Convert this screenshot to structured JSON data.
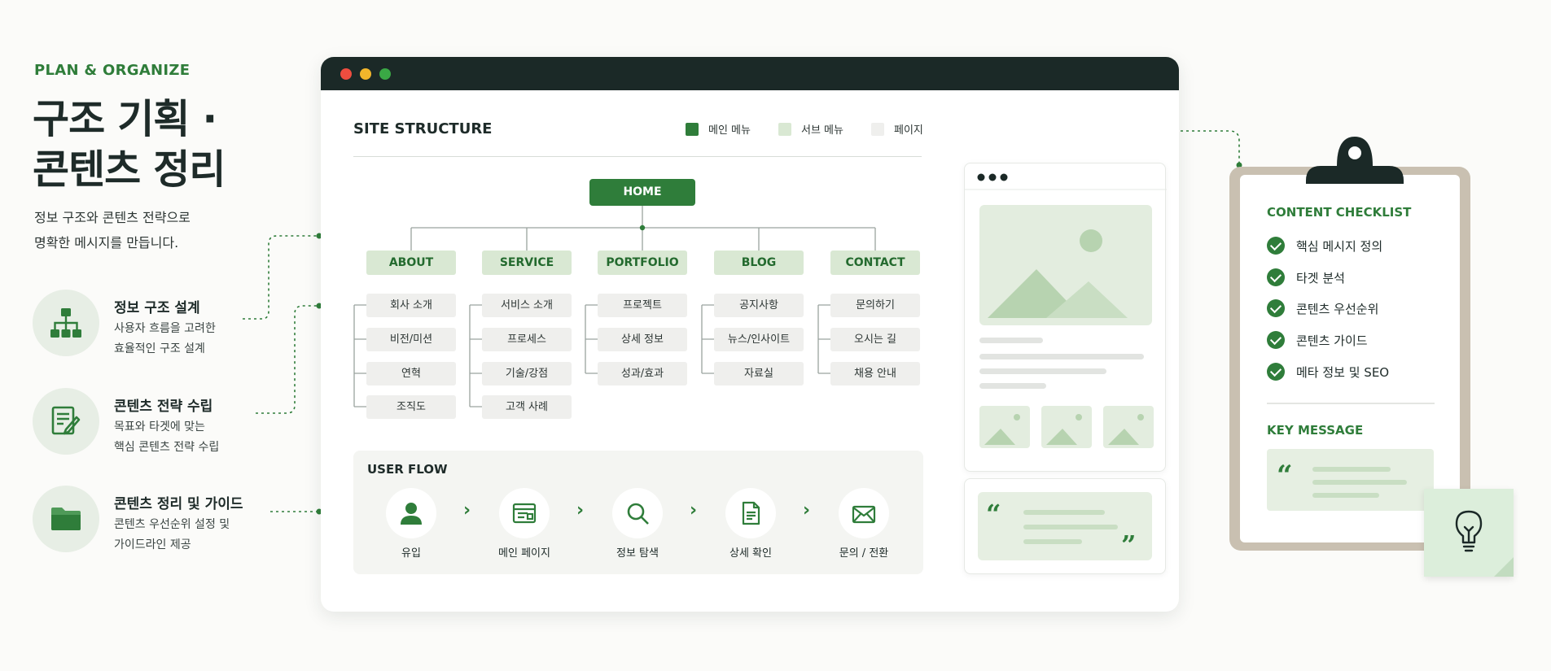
{
  "hero": {
    "eyebrow": "PLAN & ORGANIZE",
    "title_line1": "구조 기획 ·",
    "title_line2": "콘텐츠 정리",
    "intro_line1": "정보 구조와 콘텐츠 전략으로",
    "intro_line2": "명확한 메시지를 만듭니다."
  },
  "features": [
    {
      "icon": "sitemap-icon",
      "title": "정보 구조 설계",
      "desc_line1": "사용자 흐름을 고려한",
      "desc_line2": "효율적인 구조 설계"
    },
    {
      "icon": "document-edit-icon",
      "title": "콘텐츠 전략 수립",
      "desc_line1": "목표와 타겟에 맞는",
      "desc_line2": "핵심 콘텐츠 전략 수립"
    },
    {
      "icon": "folder-icon",
      "title": "콘텐츠 정리 및 가이드",
      "desc_line1": "콘텐츠 우선순위 설정 및",
      "desc_line2": "가이드라인 제공"
    }
  ],
  "structure": {
    "title": "SITE STRUCTURE",
    "legend": [
      {
        "label": "메인 메뉴",
        "color": "#2f7d3a"
      },
      {
        "label": "서브 메뉴",
        "color": "#d9e8d3"
      },
      {
        "label": "페이지",
        "color": "#efefed"
      }
    ],
    "root": "HOME",
    "menus": [
      {
        "label": "ABOUT",
        "pages": [
          "회사 소개",
          "비전/미션",
          "연혁",
          "조직도"
        ]
      },
      {
        "label": "SERVICE",
        "pages": [
          "서비스 소개",
          "프로세스",
          "기술/강점",
          "고객 사례"
        ]
      },
      {
        "label": "PORTFOLIO",
        "pages": [
          "프로젝트",
          "상세 정보",
          "성과/효과"
        ]
      },
      {
        "label": "BLOG",
        "pages": [
          "공지사항",
          "뉴스/인사이트",
          "자료실"
        ]
      },
      {
        "label": "CONTACT",
        "pages": [
          "문의하기",
          "오시는 길",
          "채용 안내"
        ]
      }
    ]
  },
  "user_flow": {
    "title": "USER FLOW",
    "steps": [
      {
        "label": "유입",
        "icon": "user-icon"
      },
      {
        "label": "메인 페이지",
        "icon": "layout-icon"
      },
      {
        "label": "정보 탐색",
        "icon": "search-icon"
      },
      {
        "label": "상세 확인",
        "icon": "document-icon"
      },
      {
        "label": "문의 / 전환",
        "icon": "mail-icon"
      }
    ]
  },
  "checklist": {
    "title": "CONTENT CHECKLIST",
    "items": [
      "핵심 메시지 정의",
      "타겟 분석",
      "콘텐츠 우선순위",
      "콘텐츠 가이드",
      "메타 정보 및 SEO"
    ],
    "key_title": "KEY MESSAGE"
  },
  "colors": {
    "accent": "#2f7d3a",
    "accent_light": "#d9e8d3",
    "page_node": "#efefed",
    "dark": "#1b2927"
  }
}
